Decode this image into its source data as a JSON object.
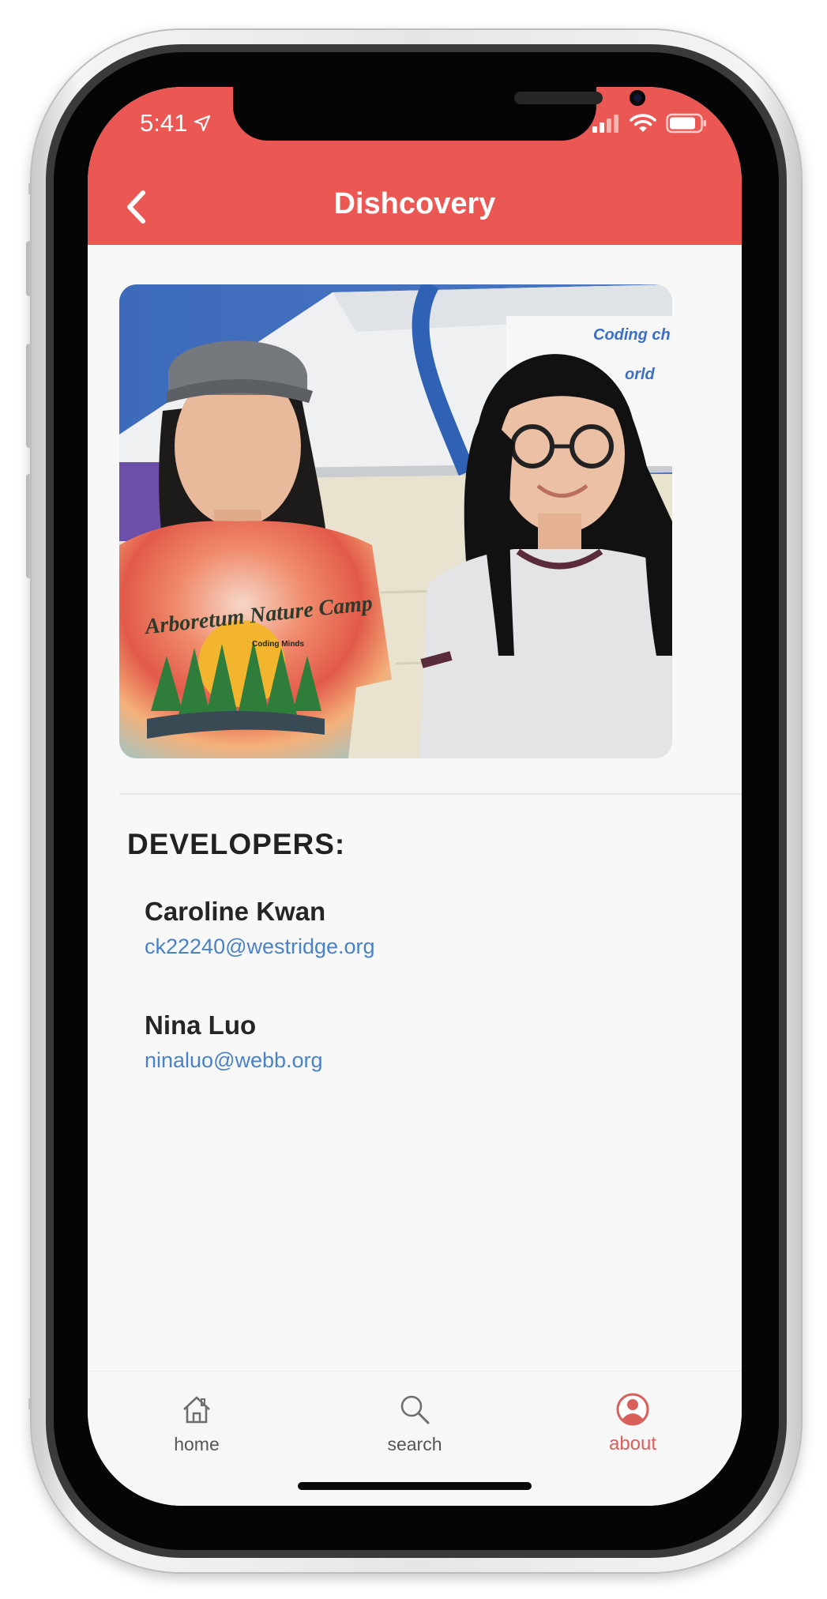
{
  "status_bar": {
    "time": "5:41"
  },
  "app_bar": {
    "title": "Dishcovery",
    "back_icon": "chevron-left-icon"
  },
  "photo": {
    "shirt_text": "Arboretum Nature Camp",
    "shirt_logo_text": "Coding Minds",
    "background_sign_text": "Coding ch... World"
  },
  "developers": {
    "heading": "DEVELOPERS:",
    "people": [
      {
        "name": "Caroline Kwan",
        "email": "ck22240@westridge.org"
      },
      {
        "name": "Nina Luo",
        "email": "ninaluo@webb.org"
      }
    ]
  },
  "bottom_nav": {
    "items": [
      {
        "label": "home",
        "icon": "home-icon",
        "active": false
      },
      {
        "label": "search",
        "icon": "search-icon",
        "active": false
      },
      {
        "label": "about",
        "icon": "user-icon",
        "active": true
      }
    ]
  },
  "colors": {
    "app_bar": "#eb5753",
    "link": "#4a82c8",
    "active_tab": "#d95f5b",
    "background": "#f8f8f8"
  }
}
